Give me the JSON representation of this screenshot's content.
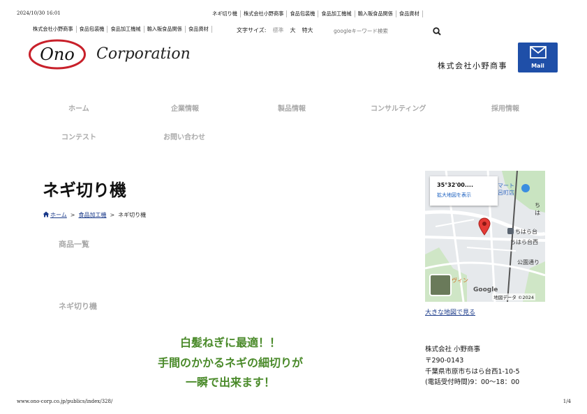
{
  "print": {
    "datetime": "2024/10/30 16:01",
    "url": "www.ono-corp.co.jp/publics/index/328/",
    "page": "1/4"
  },
  "top_links": [
    "ネギ切り機",
    "株式会社小野商事",
    "食品包装機",
    "食品加工機械",
    "輸入販食品関係",
    "食品資材"
  ],
  "sub_links": [
    "株式会社小野商事",
    "食品包装機",
    "食品加工機械",
    "輸入販食品関係",
    "食品資材"
  ],
  "font_size": {
    "label": "文字サイズ:",
    "standard": "標準",
    "large": "大",
    "extra_large": "特大"
  },
  "search": {
    "placeholder": "googleキーワード検索",
    "icon": "search-icon"
  },
  "header": {
    "company_name": "株式会社小野商事",
    "mail_label": "Mail",
    "mail_icon": "mail-icon",
    "logo_text_1": "Ono",
    "logo_text_2": "Corporation"
  },
  "global_nav": {
    "home": "ホーム",
    "company": "企業情報",
    "products": "製品情報",
    "consulting": "コンサルティング",
    "recruit": "採用情報",
    "contest": "コンテスト",
    "contact": "お問い合わせ"
  },
  "page": {
    "title": "ネギ切り機"
  },
  "breadcrumb": {
    "home": "ホーム",
    "category": "食品加工機",
    "current": "ネギ切り機",
    "separator": ">",
    "home_icon": "home-icon"
  },
  "sections": {
    "product_list": "商品一覧",
    "product_name": "ネギ切り機"
  },
  "catch": {
    "line1": "白髪ねぎに最適！！",
    "line2": "手間のかかるネギの細切りが",
    "line3": "一瞬で出来ます！"
  },
  "map": {
    "coord": "35°32'00....",
    "enlarge_link": "拡大地図を表示",
    "credit": "地図データ ©2024",
    "google": "Google",
    "label_mart": "マート",
    "label_town": "呂町店",
    "label_chiharadai": "ちはら台",
    "label_chiharadai_nishi": "ちはら台西",
    "label_park": "公園通り",
    "label_chi": "ちは",
    "label_vine": "ヴィン",
    "pin_icon": "map-pin-icon"
  },
  "big_map_link": "大きな地図で見る",
  "address": {
    "name": "株式会社 小野商事",
    "zip": "〒290-0143",
    "street": "千葉県市原市ちはら台西1-10-5",
    "hours": "(電話受付時間)9：00〜18：00"
  },
  "colors": {
    "mail_button": "#1f4fa8",
    "catch_text": "#4a8a2a",
    "link": "#1a3a8a",
    "nav_text": "#aaaaaa",
    "logo_red": "#c8202a"
  }
}
